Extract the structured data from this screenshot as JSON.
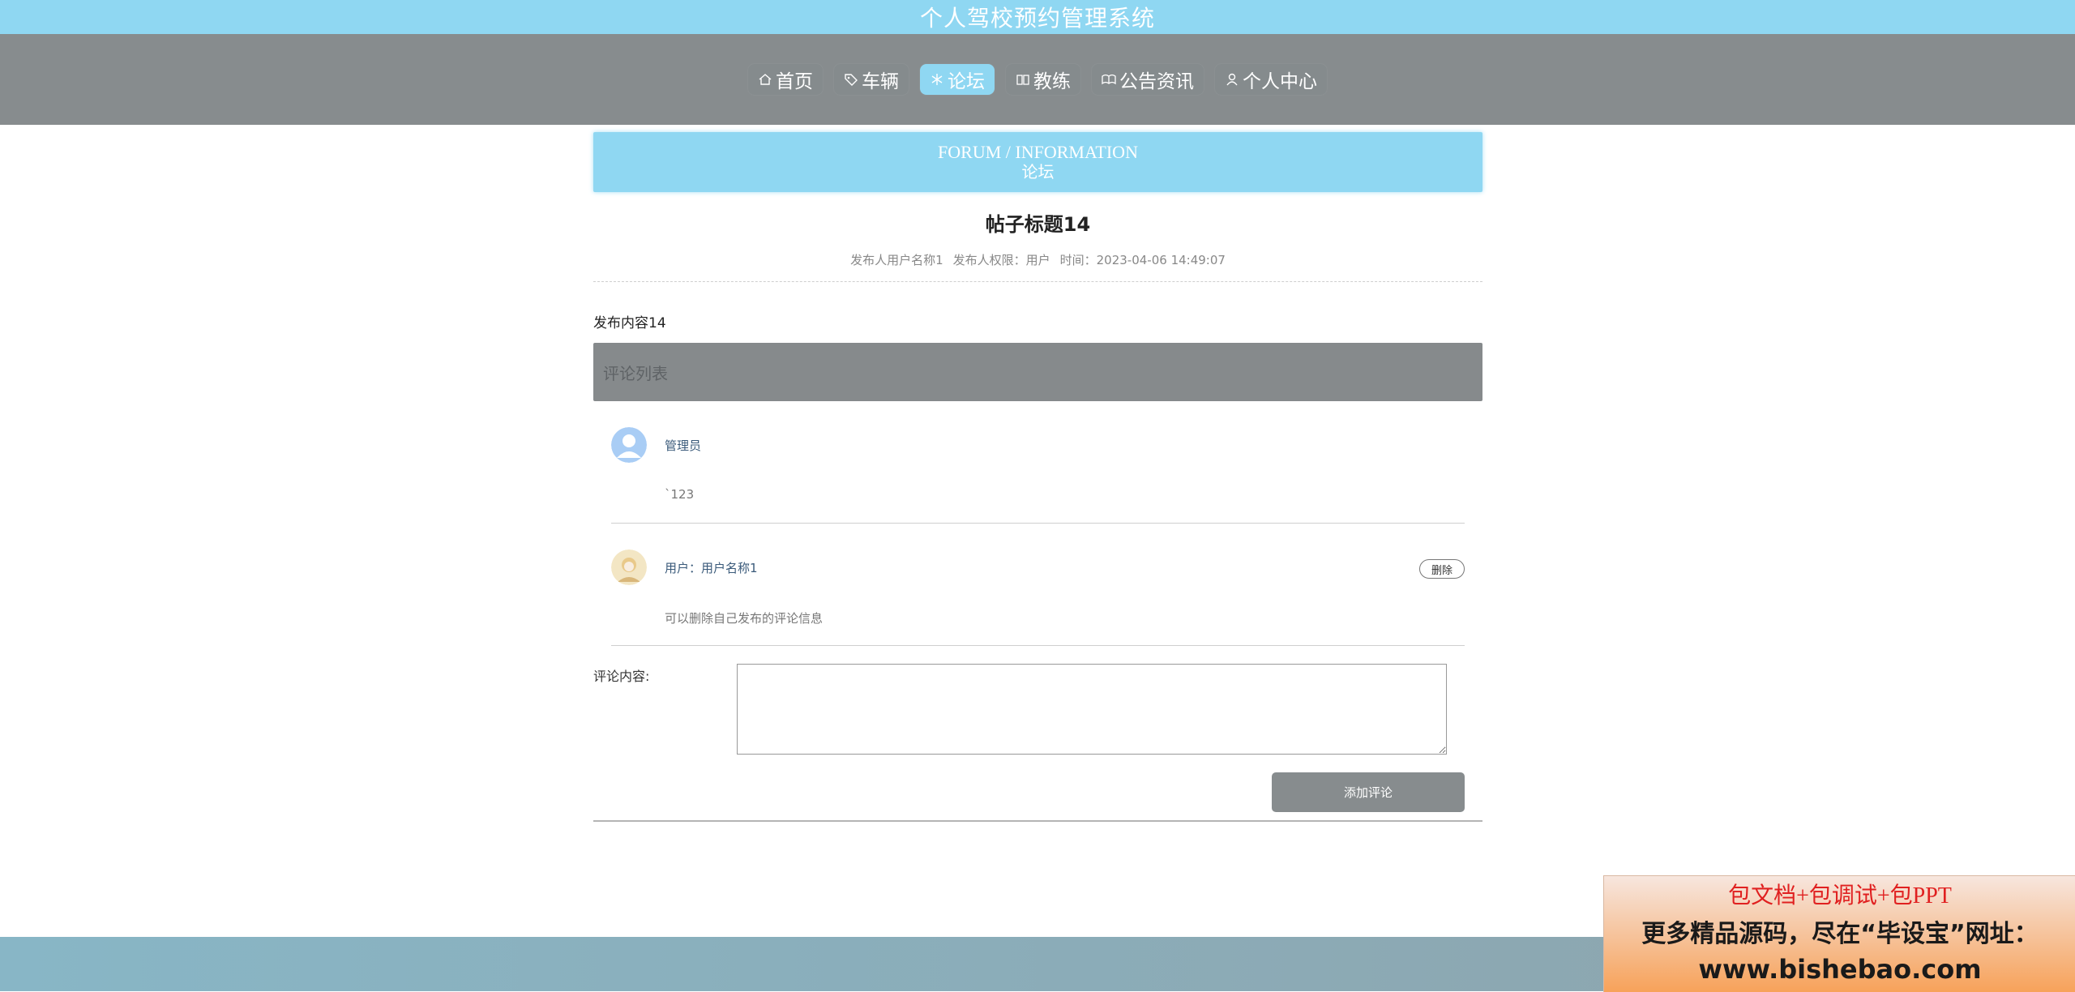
{
  "app": {
    "title": "个人驾校预约管理系统"
  },
  "nav": {
    "items": [
      {
        "label": "首页",
        "icon": "home-icon"
      },
      {
        "label": "车辆",
        "icon": "tag-icon"
      },
      {
        "label": "论坛",
        "icon": "snowflake-icon",
        "active": true
      },
      {
        "label": "教练",
        "icon": "book-icon"
      },
      {
        "label": "公告资讯",
        "icon": "open-book-icon"
      },
      {
        "label": "个人中心",
        "icon": "user-icon"
      }
    ]
  },
  "banner": {
    "en": "FORUM / INFORMATION",
    "cn": "论坛"
  },
  "post": {
    "title": "帖子标题14",
    "author": "发布人用户名称1",
    "role": "发布人权限：用户",
    "time": "时间：2023-04-06 14:49:07",
    "content": "发布内容14"
  },
  "comments": {
    "header": "评论列表",
    "items": [
      {
        "user": "管理员",
        "text": "`123",
        "avatar": "default-avatar"
      },
      {
        "user": "用户：用户名称1",
        "text": "可以删除自己发布的评论信息",
        "avatar": "user-avatar",
        "delete_label": "删除"
      }
    ]
  },
  "form": {
    "label": "评论内容:",
    "value": "",
    "submit_label": "添加评论"
  },
  "ad": {
    "line1": "包文档+包调试+包PPT",
    "line2": "更多精品源码，尽在“毕设宝”网址：",
    "line3": "www.bishebao.com"
  },
  "colors": {
    "accent": "#8fd7f2",
    "nav_bg": "#878c8e",
    "comment_header_bg": "#868a8c"
  }
}
